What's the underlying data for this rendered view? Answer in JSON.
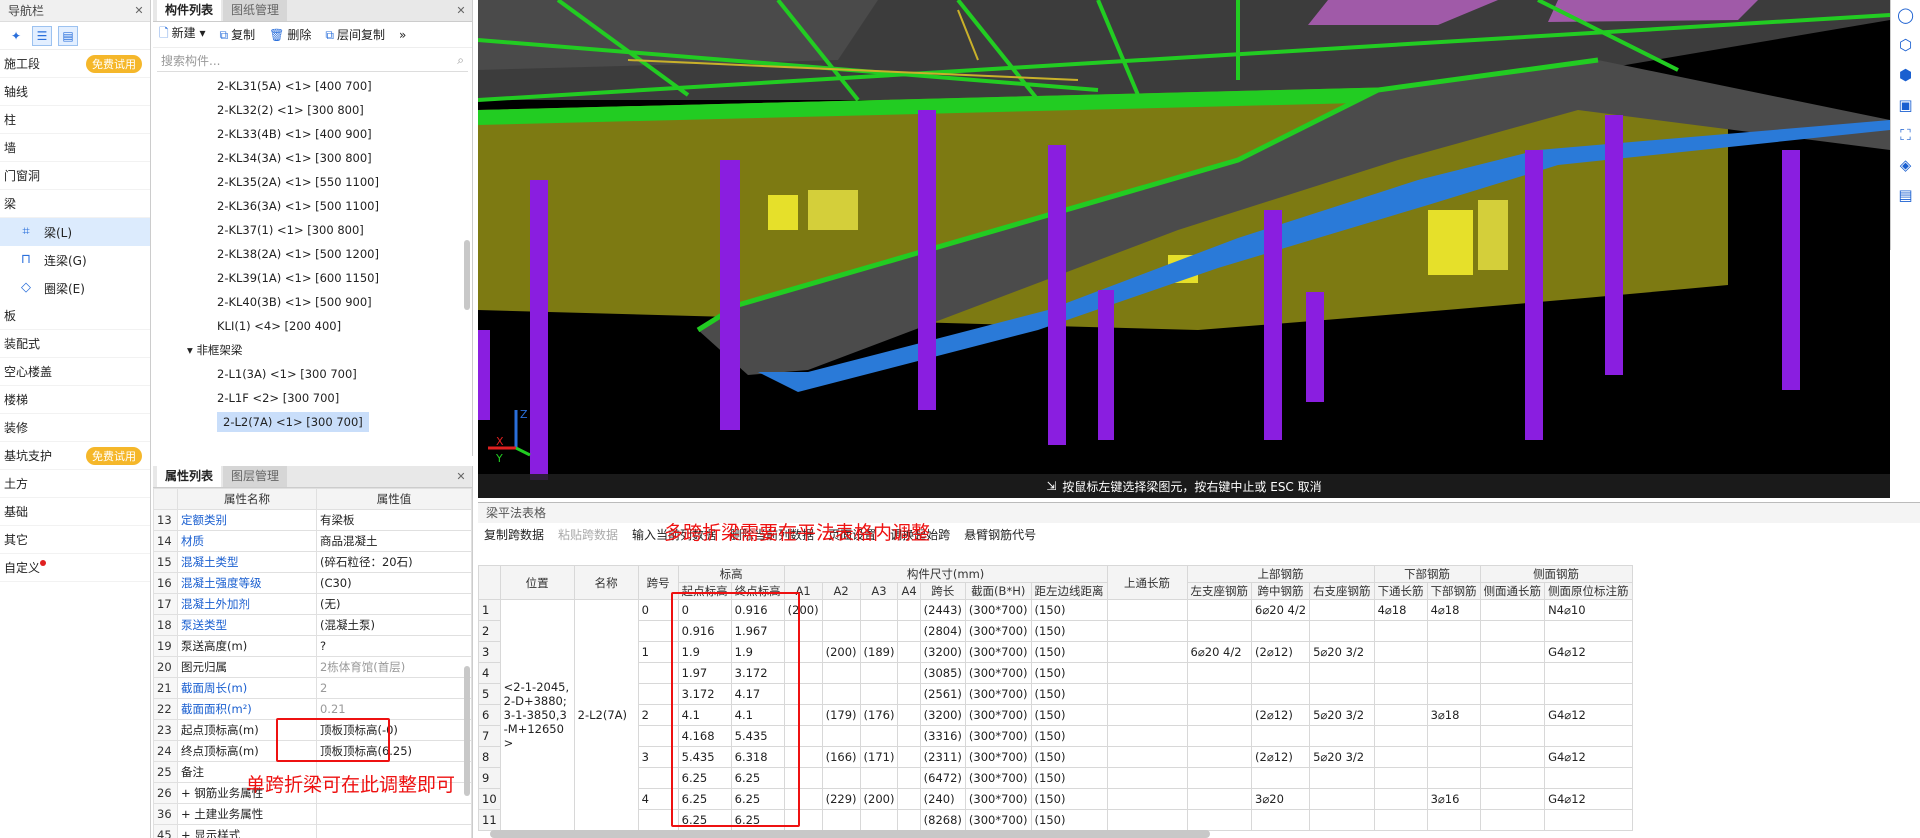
{
  "nav": {
    "title": "导航栏",
    "items": [
      {
        "label": "施工段",
        "badge": "免费试用"
      },
      {
        "label": "轴线"
      },
      {
        "label": "柱"
      },
      {
        "label": "墙"
      },
      {
        "label": "门窗洞"
      },
      {
        "label": "梁"
      },
      {
        "label": "板"
      },
      {
        "label": "装配式"
      },
      {
        "label": "空心楼盖"
      },
      {
        "label": "楼梯"
      },
      {
        "label": "装修"
      },
      {
        "label": "基坑支护",
        "badge": "免费试用"
      },
      {
        "label": "土方"
      },
      {
        "label": "基础"
      },
      {
        "label": "其它"
      },
      {
        "label": "自定义"
      }
    ],
    "beam_sub": [
      "梁(L)",
      "连梁(G)",
      "圈梁(E)"
    ]
  },
  "comp": {
    "tabs": [
      "构件列表",
      "图纸管理"
    ],
    "toolbar": [
      "新建",
      "复制",
      "删除",
      "层间复制"
    ],
    "search_placeholder": "搜索构件...",
    "items": [
      "2-KL31(5A) <1> [400 700]",
      "2-KL32(2) <1> [300 800]",
      "2-KL33(4B) <1> [400 900]",
      "2-KL34(3A) <1> [300 800]",
      "2-KL35(2A) <1> [550 1100]",
      "2-KL36(3A) <1> [500 1100]",
      "2-KL37(1) <1> [300 800]",
      "2-KL38(2A) <1> [500 1200]",
      "2-KL39(1A) <1> [600 1150]",
      "2-KL40(3B) <1> [500 900]",
      "KLI(1) <4> [200 400]"
    ],
    "group": "非框架梁",
    "group_items": [
      "2-L1(3A) <1> [300 700]",
      "2-L1F <2> [300 700]",
      "2-L2(7A) <1> [300 700]"
    ]
  },
  "props": {
    "tabs": [
      "属性列表",
      "图层管理"
    ],
    "headers": [
      "属性名称",
      "属性值"
    ],
    "rows": [
      {
        "n": "13",
        "name": "定额类别",
        "val": "有梁板",
        "blue": true
      },
      {
        "n": "14",
        "name": "材质",
        "val": "商品混凝土",
        "blue": true
      },
      {
        "n": "15",
        "name": "混凝土类型",
        "val": "(碎石粒径：20石)",
        "blue": true
      },
      {
        "n": "16",
        "name": "混凝土强度等级",
        "val": "(C30)",
        "blue": true
      },
      {
        "n": "17",
        "name": "混凝土外加剂",
        "val": "(无)",
        "blue": true
      },
      {
        "n": "18",
        "name": "泵送类型",
        "val": "(混凝土泵)",
        "blue": true
      },
      {
        "n": "19",
        "name": "泵送高度(m)",
        "val": "?"
      },
      {
        "n": "20",
        "name": "图元归属",
        "val": "2栋体育馆(首层)",
        "gray": true
      },
      {
        "n": "21",
        "name": "截面周长(m)",
        "val": "2",
        "blue": true,
        "gray": true
      },
      {
        "n": "22",
        "name": "截面面积(m²)",
        "val": "0.21",
        "blue": true,
        "gray": true
      },
      {
        "n": "23",
        "name": "起点顶标高(m)",
        "val": "顶板顶标高(-0)"
      },
      {
        "n": "24",
        "name": "终点顶标高(m)",
        "val": "顶板顶标高(6.25)"
      },
      {
        "n": "25",
        "name": "备注",
        "val": ""
      },
      {
        "n": "26",
        "name": "+ 钢筋业务属性",
        "val": ""
      },
      {
        "n": "36",
        "name": "+ 土建业务属性",
        "val": ""
      },
      {
        "n": "45",
        "name": "+ 显示样式",
        "val": ""
      }
    ],
    "note": "单跨折梁可在此调整即可"
  },
  "status": "按鼠标左键选择梁图元，按右键中止或 ESC 取消",
  "grid": {
    "title": "梁平法表格",
    "note": "多跨折梁需要在平法表格内调整",
    "toolbar": [
      "复制跨数据",
      "粘贴跨数据",
      "输入当前列数据",
      "删除当前列数据",
      "页面设置",
      "调换起始跨",
      "悬臂钢筋代号"
    ],
    "h1": [
      "位置",
      "名称",
      "跨号",
      "标高",
      "构件尺寸(mm)",
      "上通长筋",
      "上部钢筋",
      "下部钢筋",
      "侧面钢筋"
    ],
    "h2": [
      "起点标高",
      "终点标高",
      "A1",
      "A2",
      "A3",
      "A4",
      "跨长",
      "截面(B*H)",
      "距左边线距离",
      "左支座钢筋",
      "跨中钢筋",
      "右支座钢筋",
      "下通长筋",
      "下部钢筋",
      "侧面通长筋",
      "侧面原位标注筋"
    ],
    "position": "<2-1-2045,2-D+3880;3-1-3850,3-M+12650>",
    "name": "2-L2(7A)",
    "rows": [
      [
        "1",
        "0",
        "0",
        "0.916",
        "(200)",
        "",
        "",
        "",
        "(2443)",
        "(300*700)",
        "(150)",
        "",
        "",
        "6⌀20 4/2",
        "",
        "4⌀18",
        "4⌀18",
        "",
        "N4⌀10"
      ],
      [
        "2",
        "",
        "0.916",
        "1.967",
        "",
        "",
        "",
        "",
        "(2804)",
        "(300*700)",
        "(150)",
        "",
        "",
        "",
        "",
        "",
        "",
        "",
        ""
      ],
      [
        "3",
        "1",
        "1.9",
        "1.9",
        "",
        "(200)",
        "(189)",
        "",
        "(3200)",
        "(300*700)",
        "(150)",
        "",
        "6⌀20 4/2",
        "(2⌀12)",
        "5⌀20 3/2",
        "",
        "",
        "",
        "G4⌀12"
      ],
      [
        "4",
        "",
        "1.97",
        "3.172",
        "",
        "",
        "",
        "",
        "(3085)",
        "(300*700)",
        "(150)",
        "",
        "",
        "",
        "",
        "",
        "",
        "",
        ""
      ],
      [
        "5",
        "",
        "3.172",
        "4.17",
        "",
        "",
        "",
        "",
        "(2561)",
        "(300*700)",
        "(150)",
        "",
        "",
        "",
        "",
        "",
        "",
        "",
        ""
      ],
      [
        "6",
        "2",
        "4.1",
        "4.1",
        "",
        "(179)",
        "(176)",
        "",
        "(3200)",
        "(300*700)",
        "(150)",
        "",
        "",
        "(2⌀12)",
        "5⌀20 3/2",
        "",
        "3⌀18",
        "",
        "G4⌀12"
      ],
      [
        "7",
        "",
        "4.168",
        "5.435",
        "",
        "",
        "",
        "",
        "(3316)",
        "(300*700)",
        "(150)",
        "",
        "",
        "",
        "",
        "",
        "",
        "",
        ""
      ],
      [
        "8",
        "3",
        "5.435",
        "6.318",
        "",
        "(166)",
        "(171)",
        "",
        "(2311)",
        "(300*700)",
        "(150)",
        "",
        "",
        "(2⌀12)",
        "5⌀20 3/2",
        "",
        "",
        "",
        "G4⌀12"
      ],
      [
        "9",
        "",
        "6.25",
        "6.25",
        "",
        "",
        "",
        "",
        "(6472)",
        "(300*700)",
        "(150)",
        "",
        "",
        "",
        "",
        "",
        "",
        "",
        ""
      ],
      [
        "10",
        "4",
        "6.25",
        "6.25",
        "",
        "(229)",
        "(200)",
        "",
        "(240)",
        "(300*700)",
        "(150)",
        "",
        "",
        "3⌀20",
        "",
        "",
        "3⌀16",
        "",
        "G4⌀12"
      ],
      [
        "11",
        "",
        "6.25",
        "6.25",
        "",
        "",
        "",
        "",
        "(8268)",
        "(300*700)",
        "(150)",
        "",
        "",
        "",
        "",
        "",
        "",
        "",
        ""
      ]
    ]
  },
  "axis": {
    "x": "X",
    "y": "Y",
    "z": "Z"
  }
}
